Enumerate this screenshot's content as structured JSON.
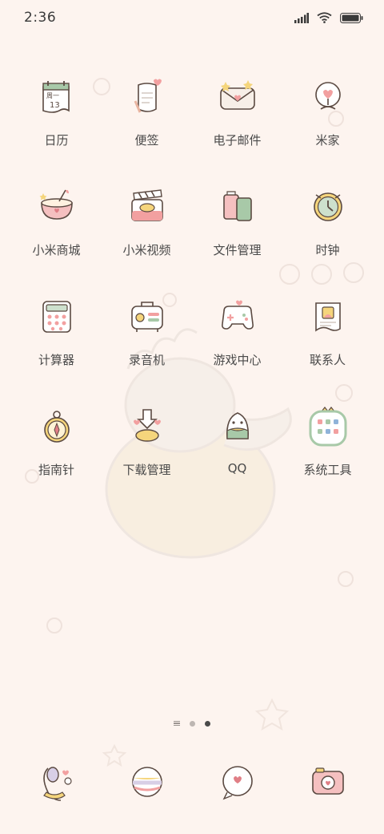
{
  "status_bar": {
    "time": "2:36",
    "icons": [
      "cellular-signal-icon",
      "wifi-icon",
      "battery-icon"
    ]
  },
  "apps": [
    {
      "label": "日历",
      "icon": "calendar-icon"
    },
    {
      "label": "便签",
      "icon": "notes-icon"
    },
    {
      "label": "电子邮件",
      "icon": "email-icon"
    },
    {
      "label": "米家",
      "icon": "mihome-icon"
    },
    {
      "label": "小米商城",
      "icon": "mi-store-icon"
    },
    {
      "label": "小米视频",
      "icon": "mi-video-icon"
    },
    {
      "label": "文件管理",
      "icon": "file-manager-icon"
    },
    {
      "label": "时钟",
      "icon": "clock-icon"
    },
    {
      "label": "计算器",
      "icon": "calculator-icon"
    },
    {
      "label": "录音机",
      "icon": "recorder-icon"
    },
    {
      "label": "游戏中心",
      "icon": "game-center-icon"
    },
    {
      "label": "联系人",
      "icon": "contacts-icon"
    },
    {
      "label": "指南针",
      "icon": "compass-icon"
    },
    {
      "label": "下载管理",
      "icon": "download-manager-icon"
    },
    {
      "label": "QQ",
      "icon": "qq-icon"
    },
    {
      "label": "系统工具",
      "icon": "system-tools-folder-icon"
    }
  ],
  "calendar_icon_text": {
    "weekday": "周一",
    "day": "13"
  },
  "page_indicator": {
    "pages": 2,
    "current_page": 2
  },
  "dock": [
    {
      "icon": "phone-icon"
    },
    {
      "icon": "browser-icon"
    },
    {
      "icon": "messages-icon"
    },
    {
      "icon": "camera-icon"
    }
  ],
  "colors": {
    "background": "#fdf4ef",
    "icon_stroke": "#5b4a42",
    "pink": "#f2a0a0",
    "yellow": "#f5d57c",
    "green": "#a8c9a8",
    "label": "#4a4a4a"
  }
}
